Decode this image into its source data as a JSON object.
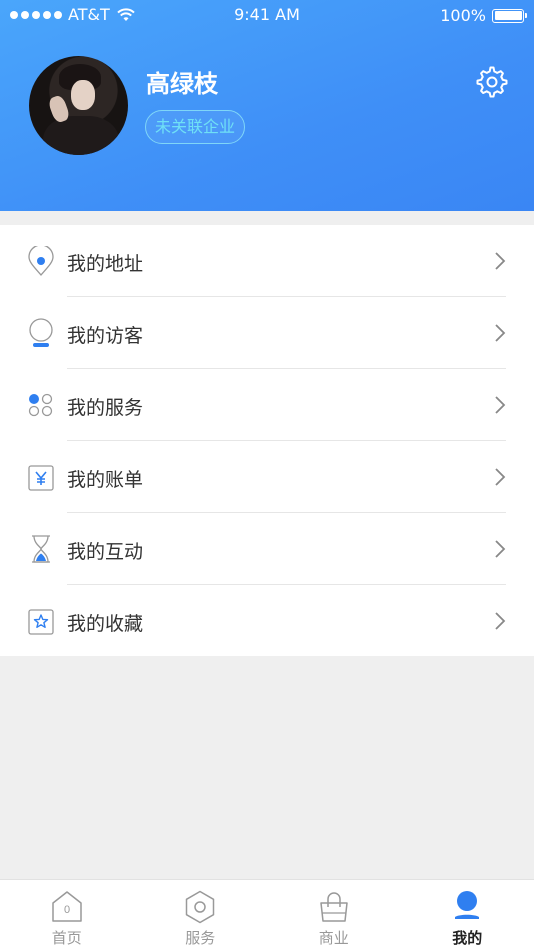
{
  "status_bar": {
    "carrier": "AT&T",
    "time": "9:41 AM",
    "battery": "100%"
  },
  "profile": {
    "name": "高绿枝",
    "company_status": "未关联企业"
  },
  "menu": {
    "items": [
      {
        "label": "我的地址",
        "icon": "location-pin-icon"
      },
      {
        "label": "我的访客",
        "icon": "visitor-icon"
      },
      {
        "label": "我的服务",
        "icon": "services-grid-icon"
      },
      {
        "label": "我的账单",
        "icon": "bill-yuan-icon"
      },
      {
        "label": "我的互动",
        "icon": "hourglass-icon"
      },
      {
        "label": "我的收藏",
        "icon": "star-icon"
      }
    ]
  },
  "tabbar": {
    "tabs": [
      {
        "label": "首页",
        "icon": "home-icon",
        "badge": "0"
      },
      {
        "label": "服务",
        "icon": "hexagon-icon"
      },
      {
        "label": "商业",
        "icon": "shopping-bag-icon"
      },
      {
        "label": "我的",
        "icon": "person-icon"
      }
    ],
    "active_index": 3
  },
  "colors": {
    "accent": "#3a8bf6",
    "header_gradient_start": "#4aa6fb",
    "header_gradient_end": "#3a86f4",
    "badge_cyan": "#6fe0f6"
  }
}
